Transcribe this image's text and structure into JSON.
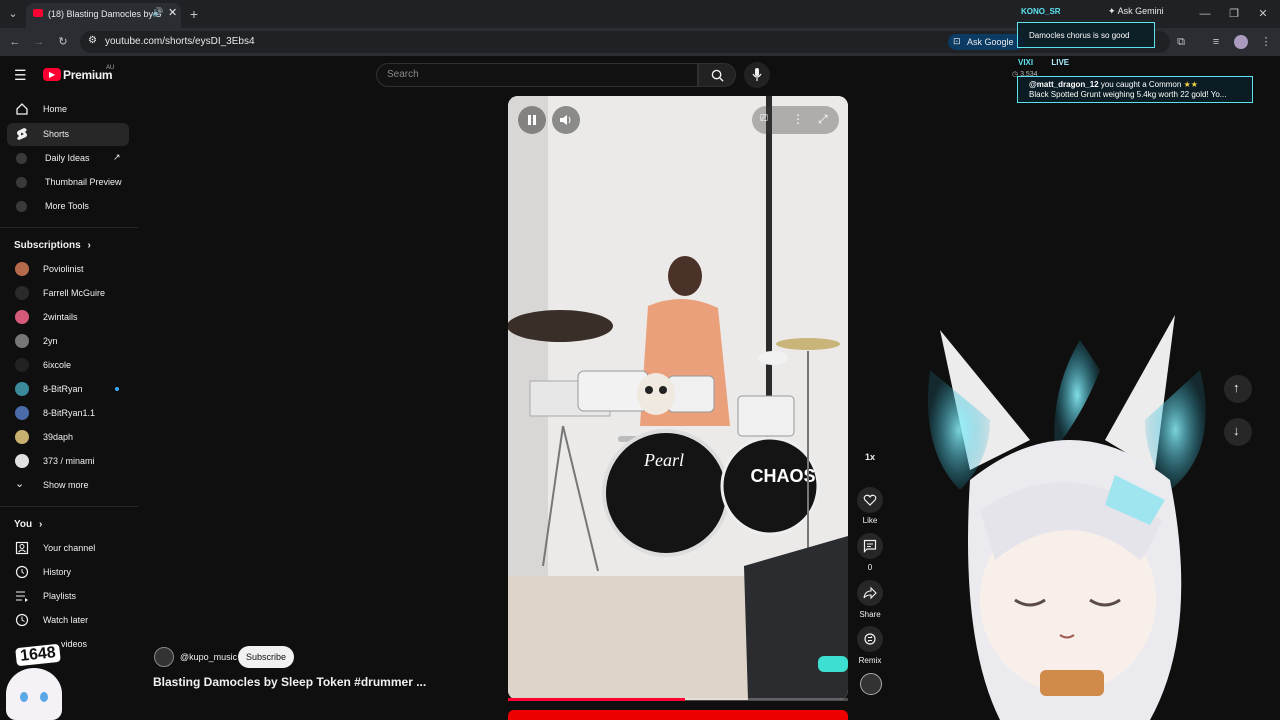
{
  "browser": {
    "tab_title": "(18) Blasting Damocles by S",
    "url": "youtube.com/shorts/eysDI_3Ebs4",
    "ask_google": "Ask Google",
    "ask_gemini": "Ask Gemini"
  },
  "youtube": {
    "logo_text": "Premium",
    "logo_region": "AU",
    "search_placeholder": "Search"
  },
  "sidebar": {
    "main": [
      {
        "label": "Home",
        "icon": "home-icon"
      },
      {
        "label": "Shorts",
        "icon": "shorts-icon"
      },
      {
        "label": "Daily Ideas",
        "icon": "extension-icon"
      },
      {
        "label": "Thumbnail Preview",
        "icon": "extension-icon"
      },
      {
        "label": "More Tools",
        "icon": "extension-icon"
      }
    ],
    "subscriptions_title": "Subscriptions",
    "subscriptions": [
      {
        "label": "Poviolinist",
        "color": "#b46a4a"
      },
      {
        "label": "Farrell McGuire",
        "color": "#2a2a2a"
      },
      {
        "label": "2wintails",
        "color": "#d45a7a"
      },
      {
        "label": "2yn",
        "color": "#777777"
      },
      {
        "label": "6ixcole",
        "color": "#222222"
      },
      {
        "label": "8-BitRyan",
        "color": "#3a8a9a"
      },
      {
        "label": "8-BitRyan1.1",
        "color": "#4a6aa8"
      },
      {
        "label": "39daph",
        "color": "#c8b070"
      },
      {
        "label": "373 / minami",
        "color": "#e0e0e0"
      }
    ],
    "show_more": "Show more",
    "you_title": "You",
    "you_items": [
      {
        "label": "Your channel"
      },
      {
        "label": "History"
      },
      {
        "label": "Playlists"
      },
      {
        "label": "Watch later"
      },
      {
        "label": "videos"
      }
    ]
  },
  "short": {
    "channel": "@kupo_music",
    "subscribe": "Subscribe",
    "title": "Blasting Damocles by Sleep Token #drummer ...",
    "speed": "1x",
    "like_label": "Like",
    "comments_count": "0",
    "share_label": "Share",
    "remix_label": "Remix",
    "progress": 0.52
  },
  "overlays": {
    "user_tag": "KONO_SR",
    "chat_message": "Damocles chorus is so good",
    "streamer_tag": "VIXI",
    "live_label": "LIVE",
    "viewer_count": "3,534",
    "notification_user": "@matt_dragon_12",
    "notification_text": "you caught a Common",
    "notification_line2": "Black Spotted Grunt weighing 5.4kg worth 22 gold! Yo...",
    "counter_badge": "1648",
    "accent": "#5de3f0"
  }
}
